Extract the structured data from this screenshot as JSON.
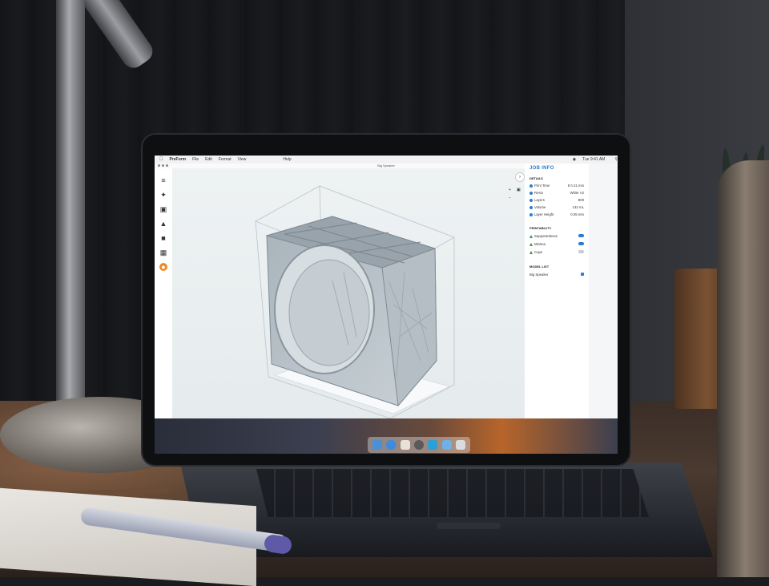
{
  "menubar": {
    "app_name": "PreForm",
    "menus": [
      "File",
      "Edit",
      "Format",
      "View",
      "Help"
    ],
    "clock": "Tue 9:41 AM"
  },
  "window": {
    "title": "Big Speaker"
  },
  "toolbar": {
    "tools": [
      "sliders-icon",
      "wand-icon",
      "layout-icon",
      "support-icon",
      "print-icon",
      "grid-icon",
      "job-icon"
    ],
    "active_tool": "job-icon"
  },
  "panel": {
    "title": "JOB INFO",
    "details": {
      "label": "DETAILS",
      "rows": [
        {
          "label": "Print Time",
          "value": "8 h 21 min"
        },
        {
          "label": "Resin",
          "value": "White V2"
        },
        {
          "label": "Layers",
          "value": "800"
        },
        {
          "label": "Volume",
          "value": "142 mL"
        },
        {
          "label": "Layer Height",
          "value": "0.05 mm"
        }
      ]
    },
    "printability": {
      "label": "PRINTABILITY",
      "rows": [
        {
          "label": "Supportedness",
          "on": true
        },
        {
          "label": "Minima",
          "on": true
        },
        {
          "label": "Cups",
          "on": false
        }
      ]
    },
    "model_list": {
      "label": "MODEL LIST",
      "items": [
        {
          "label": "Big Speaker",
          "checked": true
        }
      ]
    }
  },
  "colors": {
    "accent": "#2b7cd3",
    "active_tool": "#f08a24",
    "ok": "#3a9b3a"
  }
}
